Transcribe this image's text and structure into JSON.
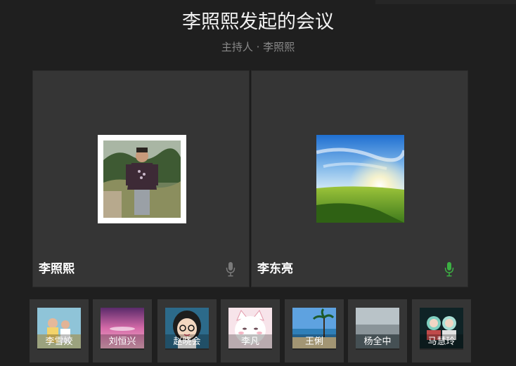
{
  "meeting": {
    "title": "李照熙发起的会议",
    "host": "主持人 · 李照熙"
  },
  "video_tiles": [
    {
      "name": "李照熙",
      "mic_icon": "microphone-icon",
      "mic_color": "#7a7a7a"
    },
    {
      "name": "李东亮",
      "mic_icon": "microphone-icon",
      "mic_color": "#3cb043"
    }
  ],
  "participants": [
    {
      "name": "李雪姣"
    },
    {
      "name": "刘恒兴"
    },
    {
      "name": "赵晓会"
    },
    {
      "name": "李凡"
    },
    {
      "name": "王俐"
    },
    {
      "name": "杨全中"
    },
    {
      "name": "马慧玲"
    }
  ],
  "colors": {
    "background": "#1f1f1f",
    "tile": "#353535",
    "active_speaker": "#3cb043"
  }
}
